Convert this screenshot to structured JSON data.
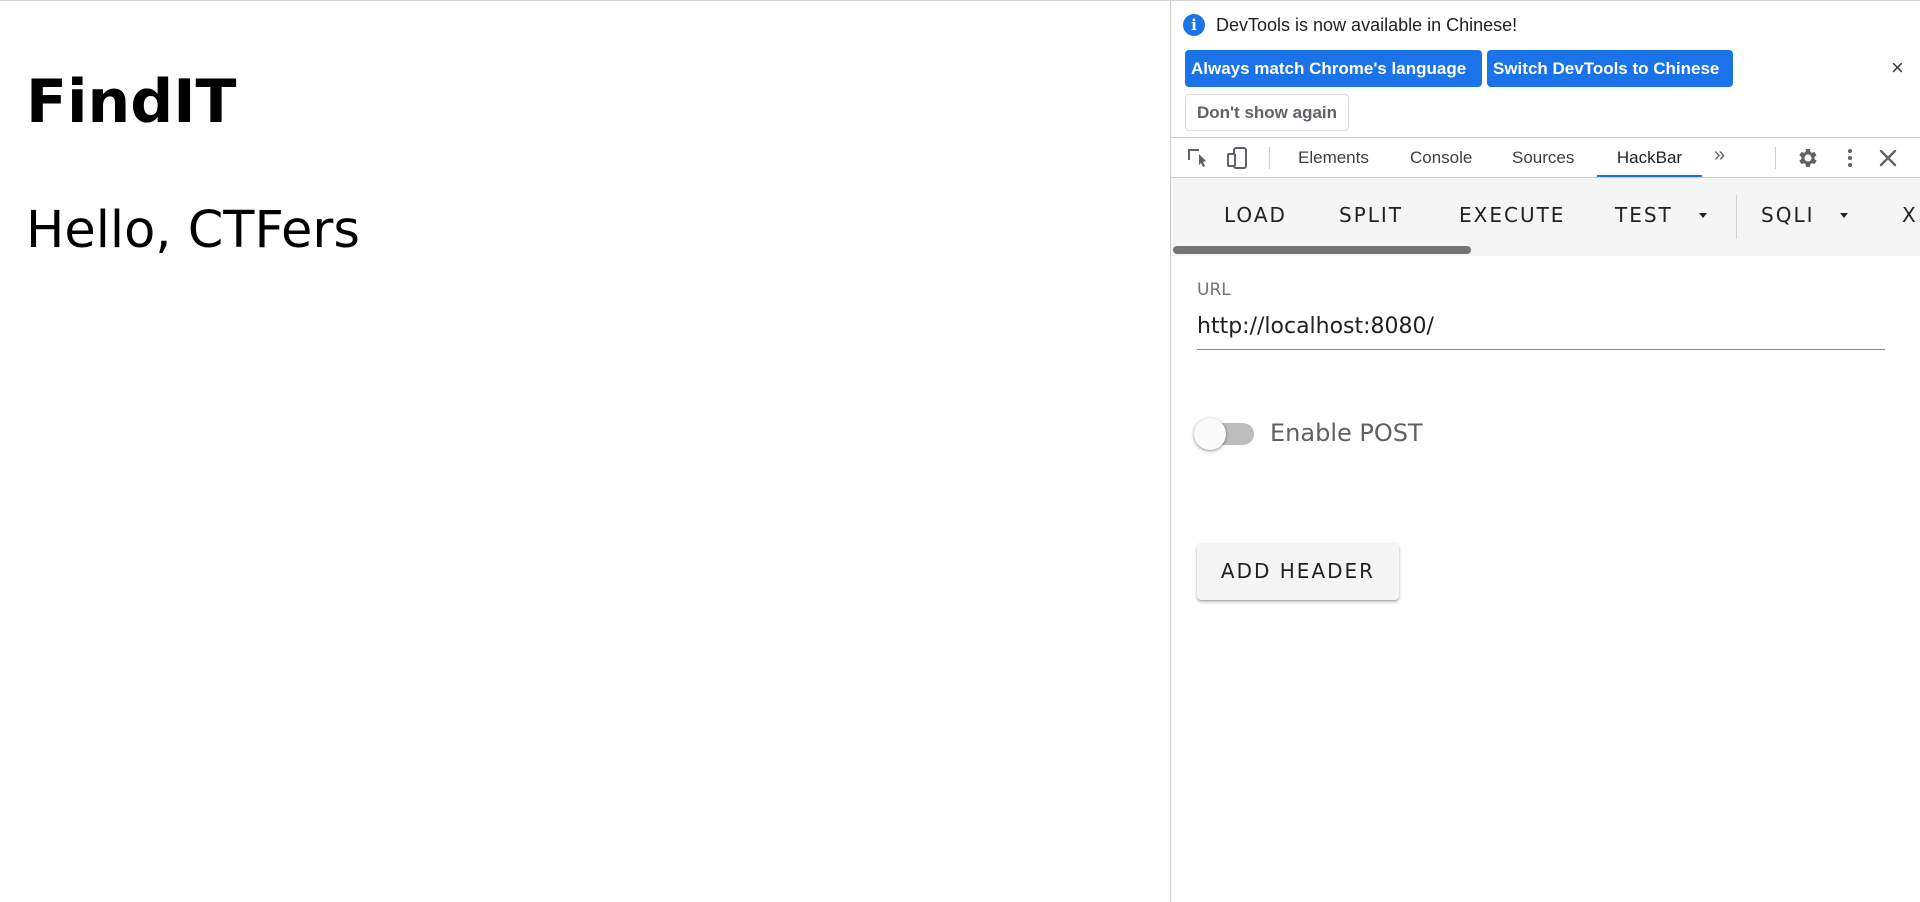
{
  "page": {
    "heading": "FindIT",
    "greeting": "Hello, CTFers"
  },
  "devtools": {
    "infobar": {
      "icon": "info-icon",
      "message": "DevTools is now available in Chinese!",
      "match_button": "Always match Chrome's language",
      "switch_button": "Switch DevTools to Chinese",
      "dismiss_button": "Don't show again",
      "close_glyph": "×"
    },
    "tabs": [
      {
        "label": "Elements",
        "active": false
      },
      {
        "label": "Console",
        "active": false
      },
      {
        "label": "Sources",
        "active": false
      },
      {
        "label": "HackBar",
        "active": true
      }
    ],
    "more_tabs_glyph": "»",
    "hackbar": {
      "buttons": {
        "load": "LOAD",
        "split": "SPLIT",
        "execute": "EXECUTE",
        "test": "TEST",
        "sqli": "SQLI",
        "next": "X"
      },
      "url_label": "URL",
      "url_value": "http://localhost:8080/",
      "enable_post_label": "Enable POST",
      "enable_post_on": false,
      "add_header": "ADD HEADER"
    },
    "colors": {
      "accent": "#1a73e8",
      "toolbar_bg": "#f5f5f5"
    }
  }
}
